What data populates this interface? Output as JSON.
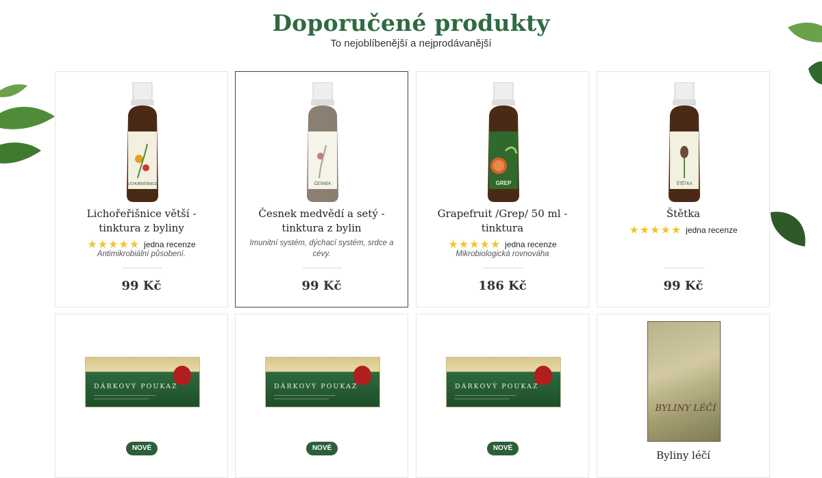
{
  "section": {
    "title": "Doporučené produkty",
    "subtitle": "To nejoblíbenější a nejprodávanější"
  },
  "products": [
    {
      "name": "Lichořeřišnice větší - tinktura z byliny",
      "label_text": "LICHOŘEŘIŠNICE",
      "rating_text": "jedna recenze",
      "stars": 5,
      "description": "Antimikrobiální působení.",
      "price": "99 Kč"
    },
    {
      "name": "Česnek medvědí a setý - tinktura z bylin",
      "label_text": "ČESNEK",
      "description": "Imunitní systém, dýchací systém, srdce a cévy.",
      "price": "99 Kč"
    },
    {
      "name": "Grapefruit /Grep/ 50 ml - tinktura",
      "label_text": "GREP",
      "rating_text": "jedna recenze",
      "stars": 5,
      "description": "Mikrobiologická rovnováha",
      "price": "186 Kč"
    },
    {
      "name": "Štětka",
      "label_text": "ŠTĚTKA",
      "rating_text": "jedna recenze",
      "stars": 5,
      "price": "99 Kč"
    }
  ],
  "row2": [
    {
      "voucher_title": "DÁRKOVÝ POUKAZ",
      "badge": "NOVÉ"
    },
    {
      "voucher_title": "DÁRKOVÝ POUKAZ",
      "badge": "NOVÉ"
    },
    {
      "voucher_title": "DÁRKOVÝ POUKAZ",
      "badge": "NOVÉ"
    },
    {
      "book_cover_title": "BYLINY LÉČÍ",
      "name": "Byliny léčí"
    }
  ],
  "colors": {
    "brand_green": "#2f6a40",
    "badge_green": "#2b5f39",
    "star_gold": "#f2c42d"
  }
}
